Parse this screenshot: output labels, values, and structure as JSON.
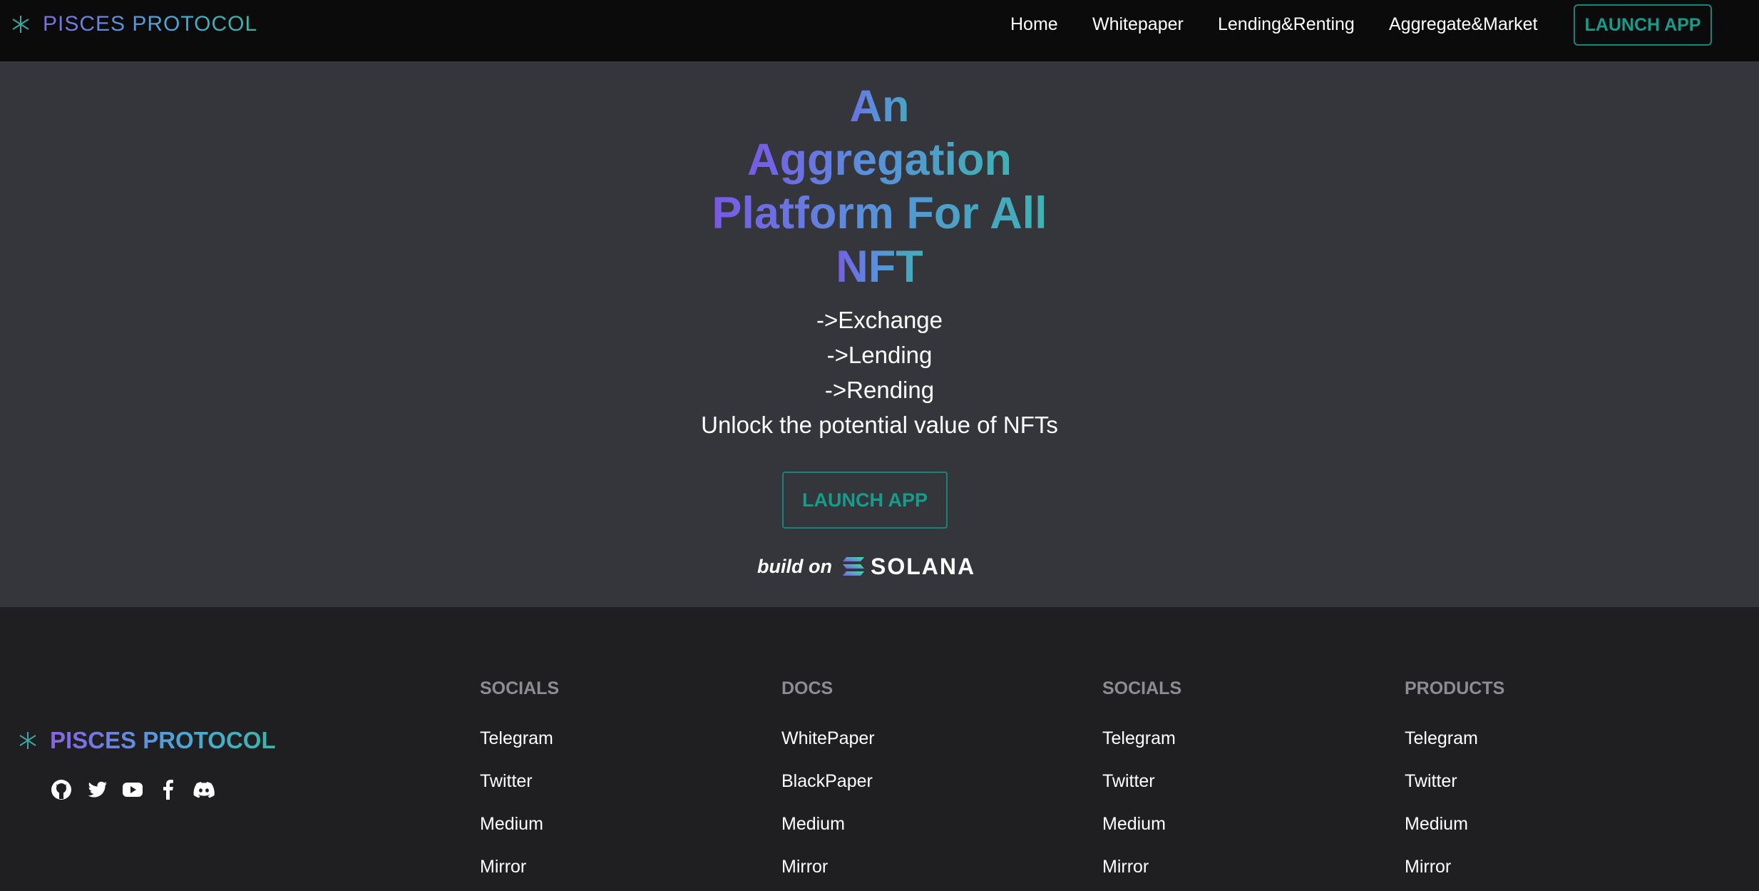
{
  "nav": {
    "brand": "PISCES PROTOCOL",
    "links": [
      "Home",
      "Whitepaper",
      "Lending&Renting",
      "Aggregate&Market"
    ],
    "launch": "LAUNCH APP"
  },
  "hero": {
    "headline": [
      "An",
      "Aggregation",
      "Platform For All",
      "NFT"
    ],
    "bullets": [
      "->Exchange",
      "->Lending",
      "->Rending"
    ],
    "tagline": "Unlock the potential value of NFTs",
    "launch": "LAUNCH APP",
    "build_on": "build on",
    "solana": "SOLANA"
  },
  "footer": {
    "brand": "PISCES PROTOCOL",
    "social_icons": [
      "github-icon",
      "twitter-icon",
      "youtube-icon",
      "facebook-icon",
      "discord-icon"
    ],
    "columns": [
      {
        "title": "SOCIALS",
        "items": [
          "Telegram",
          "Twitter",
          "Medium",
          "Mirror"
        ]
      },
      {
        "title": "DOCS",
        "items": [
          "WhitePaper",
          "BlackPaper",
          "Medium",
          "Mirror"
        ]
      },
      {
        "title": "SOCIALS",
        "items": [
          "Telegram",
          "Twitter",
          "Medium",
          "Mirror"
        ]
      },
      {
        "title": "PRODUCTS",
        "items": [
          "Telegram",
          "Twitter",
          "Medium",
          "Mirror"
        ]
      }
    ]
  },
  "colors": {
    "accent": "#159c8b",
    "hero_bg": "#35363c",
    "nav_bg": "#0b0b0c",
    "footer_bg": "#1f1f21"
  }
}
